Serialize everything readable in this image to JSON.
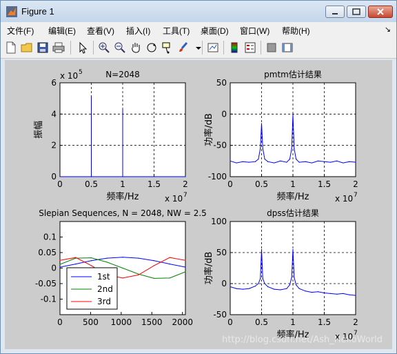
{
  "window": {
    "title": "Figure 1"
  },
  "menu": [
    "文件(F)",
    "编辑(E)",
    "查看(V)",
    "插入(I)",
    "工具(T)",
    "桌面(D)",
    "窗口(W)",
    "帮助(H)"
  ],
  "menu_corner": "↘",
  "toolbar": [
    "new-file",
    "open-folder",
    "save",
    "print",
    "pointer",
    "zoom-in",
    "zoom-out",
    "pan",
    "rotate-3d",
    "data-cursor",
    "brush",
    "link-plot",
    "colorbar",
    "legend",
    "hide-plot-tools",
    "show-plot-tools"
  ],
  "watermark": "http://blog.csdn.net/Ash_HelloWorld",
  "chart_data": [
    {
      "type": "line",
      "title": "N=2048",
      "xlabel": "频率/Hz",
      "ylabel": "振幅",
      "xlim": [
        0,
        2
      ],
      "ylim": [
        0,
        6
      ],
      "xticks": [
        "0",
        "0.5",
        "1",
        "1.5",
        "2"
      ],
      "yticks": [
        "0",
        "2",
        "4",
        "6"
      ],
      "x_exponent": "x 10",
      "x_exponent_power": "7",
      "y_exponent": "x 10",
      "y_exponent_power": "5",
      "grid": true,
      "color": "#0000ff",
      "series": [
        {
          "x": [
            0,
            0.5,
            0.5,
            0.5,
            1.0,
            1.0,
            1.0,
            2.0
          ],
          "y": [
            0,
            0,
            5.1,
            0,
            0,
            4.3,
            0,
            0
          ]
        }
      ]
    },
    {
      "type": "line",
      "title": "pmtm估计结果",
      "xlabel": "频率/Hz",
      "ylabel": "功率/dB",
      "xlim": [
        0,
        2
      ],
      "ylim": [
        -100,
        50
      ],
      "xticks": [
        "0",
        "0.5",
        "1",
        "1.5",
        "2"
      ],
      "yticks": [
        "-100",
        "-50",
        "0",
        "50"
      ],
      "x_exponent": "x 10",
      "x_exponent_power": "7",
      "grid": true,
      "color": "#0000ff",
      "series": [
        {
          "x": [
            0,
            0.1,
            0.2,
            0.3,
            0.4,
            0.45,
            0.48,
            0.5,
            0.52,
            0.55,
            0.6,
            0.7,
            0.8,
            0.9,
            0.95,
            0.98,
            1.0,
            1.02,
            1.05,
            1.1,
            1.2,
            1.3,
            1.4,
            1.5,
            1.6,
            1.7,
            1.8,
            1.9,
            2.0
          ],
          "y": [
            -75,
            -78,
            -76,
            -77,
            -76,
            -72,
            -55,
            -15,
            -55,
            -72,
            -76,
            -78,
            -75,
            -77,
            -72,
            -55,
            -1,
            -55,
            -72,
            -77,
            -76,
            -78,
            -75,
            -76,
            -77,
            -75,
            -78,
            -76,
            -77
          ]
        }
      ]
    },
    {
      "type": "line",
      "title": "Slepian Sequences, N = 2048, NW = 2.5",
      "xlim": [
        0,
        2048
      ],
      "ylim": [
        -0.15,
        0.15
      ],
      "xticks": [
        "0",
        "500",
        "1000",
        "1500",
        "2000"
      ],
      "yticks": [
        "-0.1",
        "-0.05",
        "0",
        "0.05",
        "0.1"
      ],
      "grid": false,
      "legend": "bottom-left",
      "series": [
        {
          "name": "1st",
          "color": "#0000ff",
          "x": [
            0,
            256,
            512,
            768,
            1024,
            1280,
            1536,
            1792,
            2048
          ],
          "y": [
            0.003,
            0.013,
            0.024,
            0.032,
            0.035,
            0.032,
            0.024,
            0.013,
            0.003
          ]
        },
        {
          "name": "2nd",
          "color": "#008000",
          "x": [
            0,
            256,
            512,
            768,
            1024,
            1280,
            1536,
            1792,
            2048
          ],
          "y": [
            0.012,
            0.032,
            0.033,
            0.019,
            0.0,
            -0.019,
            -0.033,
            -0.032,
            -0.012
          ]
        },
        {
          "name": "3rd",
          "color": "#ff0000",
          "x": [
            0,
            256,
            512,
            768,
            1024,
            1280,
            1536,
            1792,
            2048
          ],
          "y": [
            0.025,
            0.034,
            0.008,
            -0.022,
            -0.032,
            -0.022,
            0.008,
            0.034,
            0.025
          ]
        }
      ]
    },
    {
      "type": "line",
      "title": "dpss估计结果",
      "xlabel": "频率/Hz",
      "ylabel": "功率/dB",
      "xlim": [
        0,
        2
      ],
      "ylim": [
        -50,
        100
      ],
      "xticks": [
        "0",
        "0.5",
        "1",
        "1.5",
        "2"
      ],
      "yticks": [
        "-50",
        "0",
        "50",
        "100"
      ],
      "x_exponent": "x 10",
      "x_exponent_power": "7",
      "grid": true,
      "color": "#0000ff",
      "series": [
        {
          "x": [
            0,
            0.1,
            0.2,
            0.3,
            0.4,
            0.45,
            0.48,
            0.5,
            0.52,
            0.55,
            0.6,
            0.7,
            0.8,
            0.9,
            0.95,
            0.98,
            1.0,
            1.02,
            1.05,
            1.1,
            1.2,
            1.3,
            1.4,
            1.5,
            1.6,
            1.7,
            1.8,
            1.9,
            2.0
          ],
          "y": [
            -5,
            -8,
            -9,
            -8,
            -4,
            0,
            8,
            55,
            8,
            0,
            -5,
            -9,
            -10,
            -8,
            -2,
            10,
            55,
            10,
            -2,
            -8,
            -12,
            -14,
            -13,
            -15,
            -16,
            -17,
            -16,
            -18,
            -19
          ]
        }
      ]
    }
  ]
}
